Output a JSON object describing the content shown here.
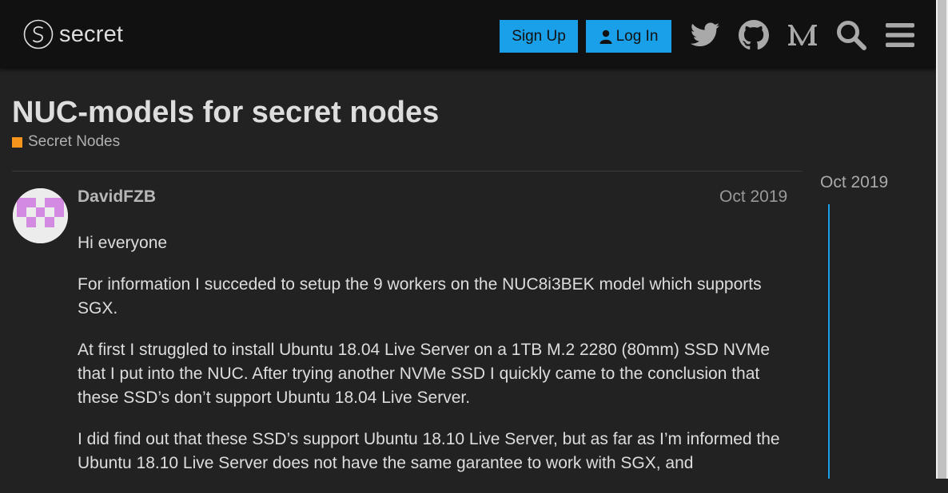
{
  "header": {
    "logo_text": "secret",
    "signup_label": "Sign Up",
    "login_label": "Log In",
    "icons": [
      "twitter-icon",
      "github-icon",
      "medium-icon",
      "search-icon",
      "hamburger-menu-icon"
    ]
  },
  "topic": {
    "title": "NUC-models for secret nodes",
    "category": "Secret Nodes",
    "category_color": "#f7941d"
  },
  "post": {
    "author": "DavidFZB",
    "date": "Oct 2019",
    "paragraphs": [
      "Hi everyone",
      "For information I succeded to setup the 9 workers on the NUC8i3BEK model which supports SGX.",
      "At first I struggled to install Ubuntu 18.04 Live Server on a 1TB M.2 2280 (80mm) SSD NVMe that I put into the NUC. After trying another NVMe SSD I quickly came to the conclusion that these SSD’s don’t support Ubuntu 18.04 Live Server.",
      "I did find out that these SSD’s support Ubuntu 18.10 Live Server, but as far as I’m informed the Ubuntu 18.10 Live Server does not have the same garantee to work with SGX, and"
    ]
  },
  "timeline": {
    "date": "Oct 2019"
  },
  "colors": {
    "accent": "#1aa0e8",
    "background": "#222222",
    "header_bg": "#111111"
  }
}
